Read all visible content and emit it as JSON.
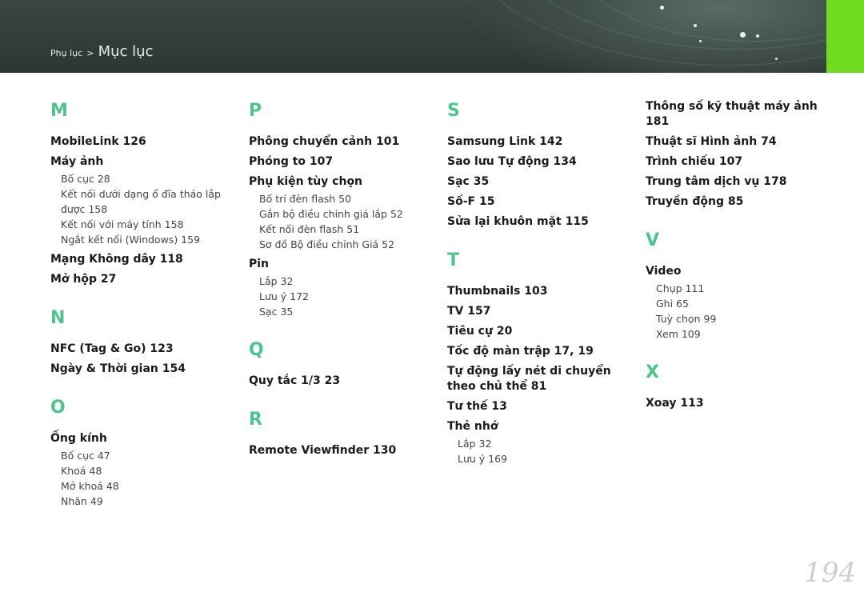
{
  "header": {
    "breadcrumb_parent": "Phụ lục",
    "breadcrumb_sep": ">",
    "breadcrumb_current": "Mục lục",
    "accent_color": "#6ddc1e"
  },
  "index": {
    "M": {
      "letter": "M",
      "entries": [
        {
          "text": "MobileLink  126"
        },
        {
          "text": "Máy ảnh",
          "subs": [
            "Bố cục  28",
            "Kết nối dưới dạng ổ đĩa tháo lắp được  158",
            "Kết nối với máy tính  158",
            "Ngắt kết nối (Windows)  159"
          ]
        },
        {
          "text": "Mạng Không dây  118"
        },
        {
          "text": "Mở hộp  27"
        }
      ]
    },
    "N": {
      "letter": "N",
      "entries": [
        {
          "text": "NFC (Tag & Go)  123"
        },
        {
          "text": "Ngày & Thời gian  154"
        }
      ]
    },
    "O": {
      "letter": "O",
      "entries": [
        {
          "text": "Ống kính",
          "subs": [
            "Bố cục  47",
            "Khoá  48",
            "Mở khoá  48",
            "Nhãn  49"
          ]
        }
      ]
    },
    "P": {
      "letter": "P",
      "entries": [
        {
          "text": "Phông chuyển cảnh  101"
        },
        {
          "text": "Phóng to  107"
        },
        {
          "text": "Phụ kiện tùy chọn",
          "subs": [
            "Bố trí đèn flash  50",
            "Gắn bộ điều chỉnh giá lắp  52",
            "Kết nối đèn flash  51",
            "Sơ đồ Bộ điều chỉnh Giá  52"
          ]
        },
        {
          "text": "Pin",
          "subs": [
            "Lắp  32",
            "Lưu ý  172",
            "Sạc  35"
          ]
        }
      ]
    },
    "Q": {
      "letter": "Q",
      "entries": [
        {
          "text": "Quy tắc 1/3  23"
        }
      ]
    },
    "R": {
      "letter": "R",
      "entries": [
        {
          "text": "Remote Viewfinder  130"
        }
      ]
    },
    "S": {
      "letter": "S",
      "entries": [
        {
          "text": "Samsung Link  142"
        },
        {
          "text": "Sao lưu Tự động  134"
        },
        {
          "text": "Sạc  35"
        },
        {
          "text": "Số-F  15"
        },
        {
          "text": "Sửa lại khuôn mặt  115"
        }
      ]
    },
    "T": {
      "letter": "T",
      "entries": [
        {
          "text": "Thumbnails  103"
        },
        {
          "text": "TV  157"
        },
        {
          "text": "Tiêu cự  20"
        },
        {
          "text": "Tốc độ màn trập  17, 19"
        },
        {
          "text": "Tự động lấy nét di chuyển theo chủ thể  81"
        },
        {
          "text": "Tư thế  13"
        },
        {
          "text": "Thẻ nhớ",
          "subs": [
            "Lắp  32",
            "Lưu ý  169"
          ]
        },
        {
          "text": "Thông số kỹ thuật máy ảnh  181"
        },
        {
          "text": "Thuật sĩ Hình ảnh  74"
        },
        {
          "text": "Trình chiếu  107"
        },
        {
          "text": "Trung tâm dịch vụ  178"
        },
        {
          "text": "Truyền động  85"
        }
      ]
    },
    "V": {
      "letter": "V",
      "entries": [
        {
          "text": "Video",
          "subs": [
            "Chụp  111",
            "Ghi  65",
            "Tuỳ chọn  99",
            "Xem  109"
          ]
        }
      ]
    },
    "X": {
      "letter": "X",
      "entries": [
        {
          "text": "Xoay  113"
        }
      ]
    }
  },
  "page_number": "194"
}
